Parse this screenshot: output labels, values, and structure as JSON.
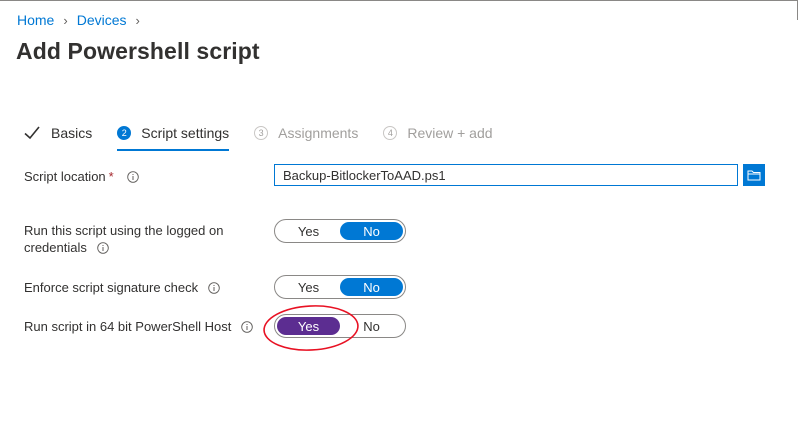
{
  "breadcrumb": {
    "home": "Home",
    "devices": "Devices"
  },
  "page": {
    "title": "Add Powershell script"
  },
  "steps": [
    {
      "number": "",
      "label": "Basics",
      "state": "done"
    },
    {
      "number": "2",
      "label": "Script settings",
      "state": "active"
    },
    {
      "number": "3",
      "label": "Assignments",
      "state": "inactive"
    },
    {
      "number": "4",
      "label": "Review + add",
      "state": "inactive"
    }
  ],
  "form": {
    "script_location": {
      "label": "Script location",
      "required_mark": "*",
      "value": "Backup-BitlockerToAAD.ps1"
    },
    "run_logged_on": {
      "label_line1": "Run this script using the logged on",
      "label_line2": "credentials",
      "yes": "Yes",
      "no": "No",
      "selected": "No"
    },
    "enforce_signature": {
      "label": "Enforce script signature check",
      "yes": "Yes",
      "no": "No",
      "selected": "No"
    },
    "run_64bit": {
      "label": "Run script in 64 bit PowerShell Host",
      "yes": "Yes",
      "no": "No",
      "selected": "Yes"
    }
  },
  "colors": {
    "accent": "#0078d4",
    "selected_purple": "#5c2d91",
    "highlight_circle": "#e81123"
  },
  "icons": {
    "info": "info-icon",
    "check": "checkmark-icon",
    "browse": "folder-browse-icon"
  }
}
